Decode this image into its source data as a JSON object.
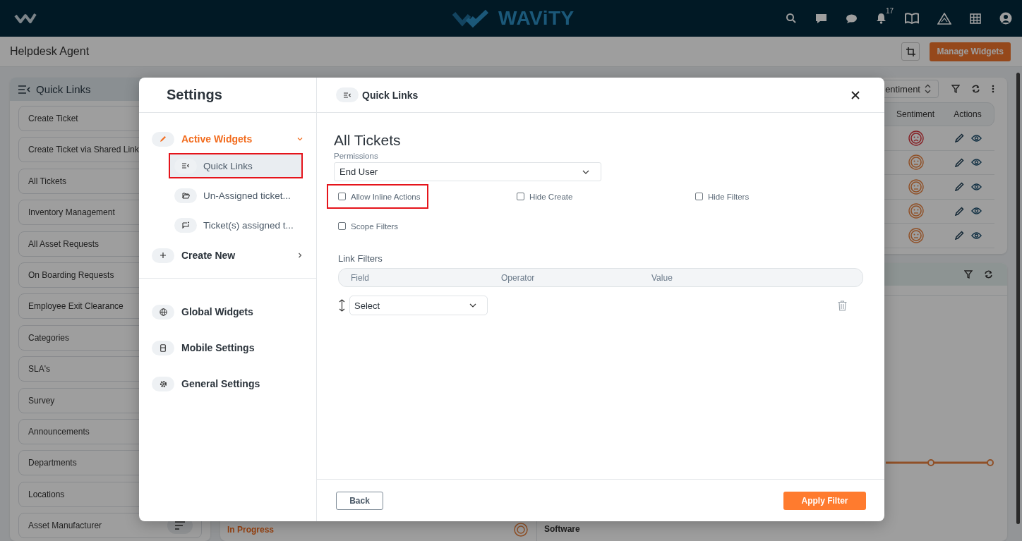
{
  "topbar": {
    "brand": "WAViTY",
    "notification_count": "17"
  },
  "page": {
    "title": "Helpdesk Agent",
    "manage_button": "Manage Widgets"
  },
  "quick_links_widget": {
    "title": "Quick Links",
    "items": [
      "Create Ticket",
      "Create Ticket via Shared Link",
      "All Tickets",
      "Inventory Management",
      "All Asset Requests",
      "On Boarding Requests",
      "Employee Exit Clearance",
      "Categories",
      "SLA's",
      "Survey",
      "Announcements",
      "Departments",
      "Locations",
      "Asset Manufacturer"
    ]
  },
  "sentiment_widget": {
    "sort_select": "entiment",
    "columns": [
      "Sentiment",
      "Actions"
    ],
    "rows": [
      {
        "kind": "sad"
      },
      {
        "kind": "neutral"
      },
      {
        "kind": "neutral"
      },
      {
        "kind": "neutral"
      },
      {
        "kind": "neutral"
      }
    ]
  },
  "status_widget": {
    "status": "In Progress",
    "category": "Software"
  },
  "settings": {
    "title": "Settings",
    "nav": [
      {
        "label": "Active Widgets",
        "active": true,
        "expanded": true,
        "children": [
          {
            "label": "Quick Links",
            "selected": true,
            "highlighted": true
          },
          {
            "label": "Un-Assigned ticket...",
            "selected": false,
            "highlighted": false
          },
          {
            "label": "Ticket(s) assigned t...",
            "selected": false,
            "highlighted": false
          }
        ]
      },
      {
        "label": "Create New",
        "active": false,
        "expanded": false
      }
    ],
    "nav_lower": [
      "Global Widgets",
      "Mobile Settings",
      "General Settings"
    ]
  },
  "panel": {
    "header": "Quick Links",
    "heading": "All Tickets",
    "permissions_label": "Permissions",
    "permissions_value": "End User",
    "options": [
      {
        "label": "Allow Inline Actions",
        "checked": false,
        "highlighted": true
      },
      {
        "label": "Hide Create",
        "checked": false,
        "highlighted": false
      },
      {
        "label": "Hide Filters",
        "checked": false,
        "highlighted": false
      },
      {
        "label": "Scope Filters",
        "checked": false,
        "highlighted": false
      }
    ],
    "link_filters": {
      "title": "Link Filters",
      "columns": [
        "Field",
        "Operator",
        "Value"
      ],
      "rows": [
        {
          "field": "Select"
        }
      ]
    },
    "back_button": "Back",
    "apply_button": "Apply Filter"
  }
}
